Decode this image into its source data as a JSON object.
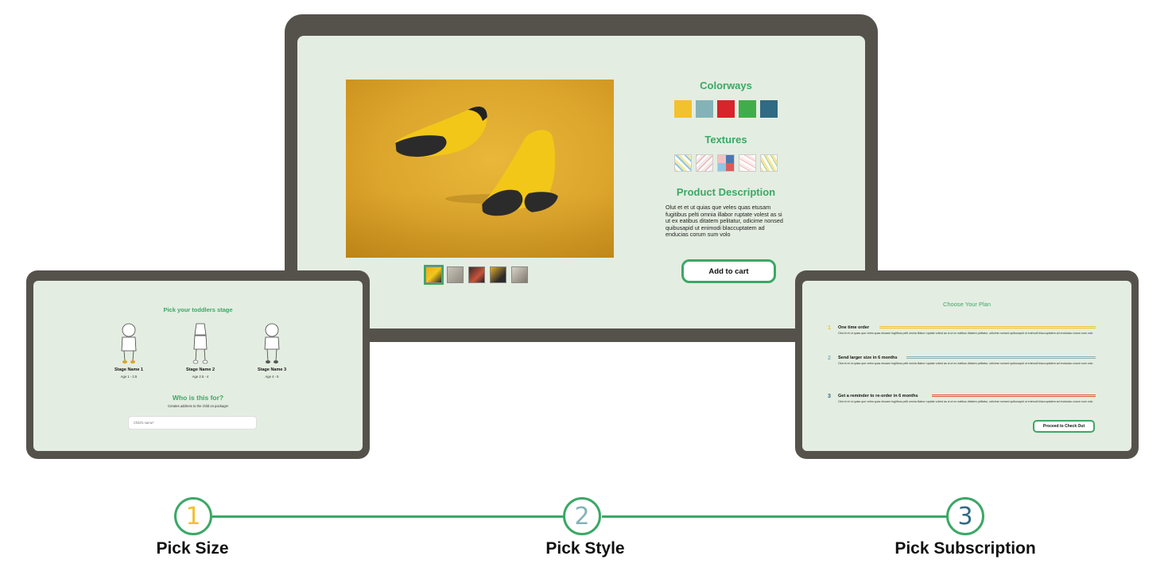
{
  "center": {
    "colorways_title": "Colorways",
    "colorways": [
      "#f2c12e",
      "#84b3b7",
      "#d8242b",
      "#3fae4a",
      "#2f6b82"
    ],
    "textures_title": "Textures",
    "description_title": "Product Description",
    "description": "Olut et et ut quias que veles quas etusam fugitibus pelti omnia illabor ruptate volest as si ut ex eatibus ditatem pelitatur, odicime nonsed quibusapid ut enimodi blaccuptatem ad enducias corum sum volo",
    "add_to_cart": "Add to cart"
  },
  "left": {
    "title": "Pick your toddlers stage",
    "stages": [
      {
        "name": "Stage Name 1",
        "age": "Age 1 - 2.5"
      },
      {
        "name": "Stage Name 2",
        "age": "Age 2.5 - 4"
      },
      {
        "name": "Stage Name 3",
        "age": "Age 4 - 5"
      }
    ],
    "who_title": "Who is this for?",
    "who_sub": "Creates address to the child on package!",
    "child_placeholder": "Child's name*"
  },
  "right": {
    "title": "Choose Your Plan",
    "plans": [
      {
        "num": "1",
        "title": "One time order",
        "color": "#f2c12e",
        "body": "Olut et et ut quias que veles quas etusam fugitibus pelti omnia illabor ruptate volest as si ut ex eatibus ditatem pelitatur, odicime nonsed quibusapid ut enimodi blaccuptatem ad enducias corum sum volo"
      },
      {
        "num": "2",
        "title": "Send larger size in 6 months",
        "color": "#84b3b7",
        "body": "Olut et et ut quias que veles quas etusam fugitibus pelti omnia illabor ruptate volest as si ut ex eatibus ditatem pelitatur, odicime nonsed quibusapid ut enimodi blaccuptatem ad enducias corum sum volo"
      },
      {
        "num": "3",
        "title": "Get a reminder to re-order in 6 months",
        "color": "#e2533a",
        "body": "Olut et et ut quias que veles quas etusam fugitibus pelti omnia illabor ruptate volest as si ut ex eatibus ditatem pelitatur, odicime nonsed quibusapid ut enimodi blaccuptatem ad enducias corum sum volo"
      }
    ],
    "checkout": "Proceed to Check Out"
  },
  "steps": [
    {
      "num": "1",
      "label": "Pick Size",
      "color": "#f2c12e"
    },
    {
      "num": "2",
      "label": "Pick Style",
      "color": "#84b3b7"
    },
    {
      "num": "3",
      "label": "Pick Subscription",
      "color": "#2f6b82"
    }
  ],
  "colors": {
    "accent": "#3ba866",
    "device": "#55524c",
    "screen": "#e4ede1"
  }
}
